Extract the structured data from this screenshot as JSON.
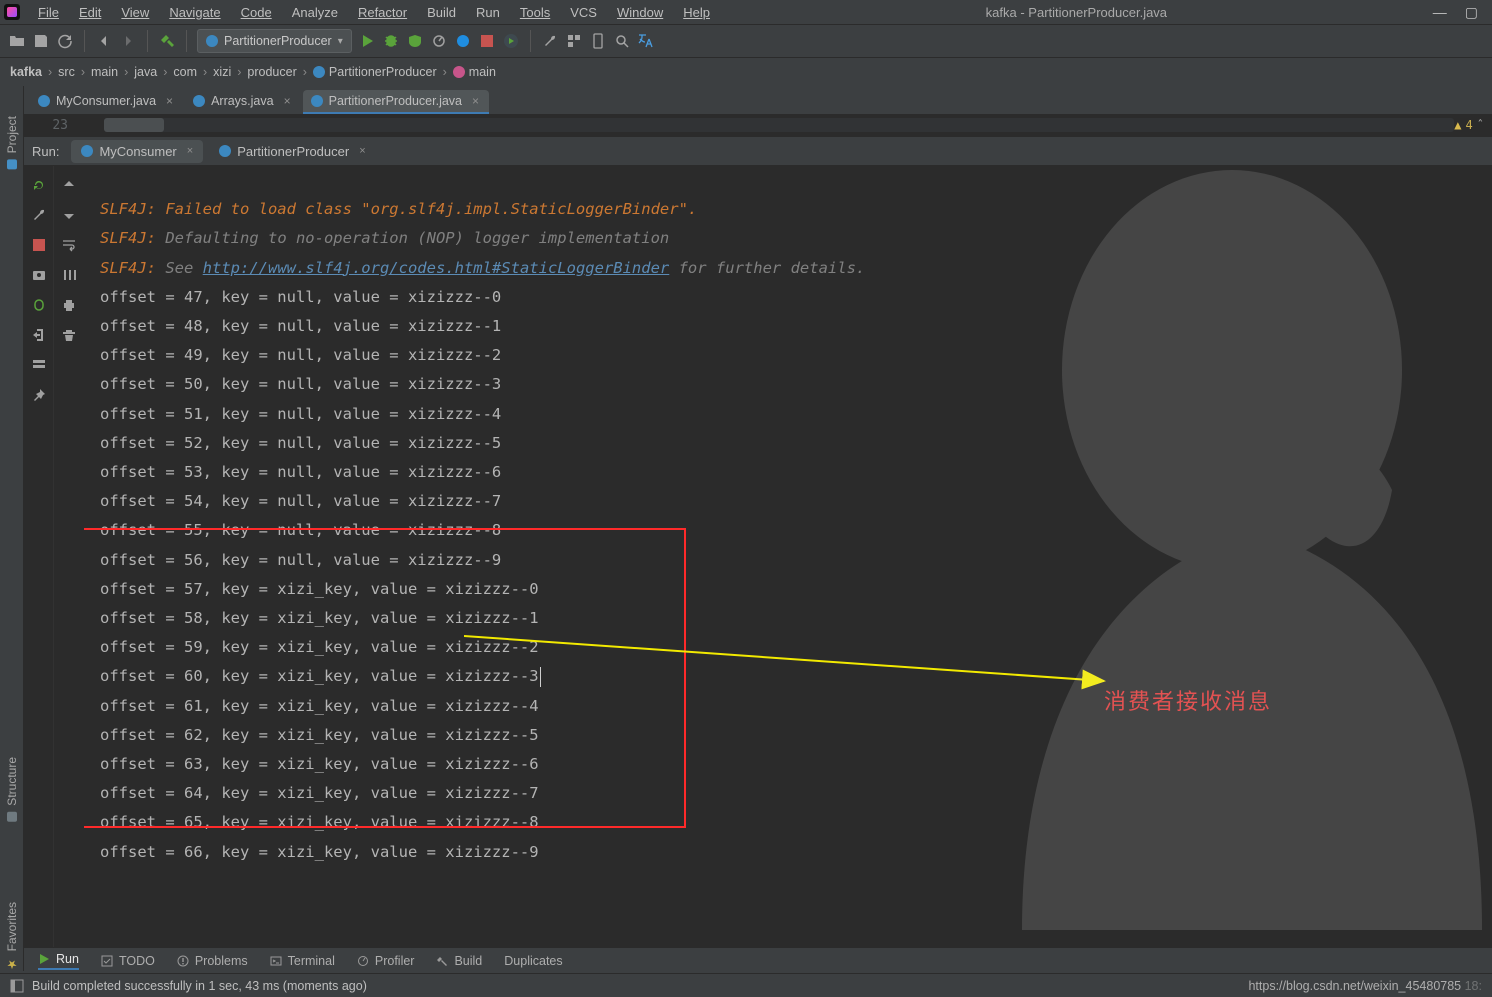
{
  "window": {
    "title": "kafka - PartitionerProducer.java"
  },
  "menu": {
    "file": "File",
    "edit": "Edit",
    "view": "View",
    "navigate": "Navigate",
    "code": "Code",
    "analyze": "Analyze",
    "refactor": "Refactor",
    "build": "Build",
    "run": "Run",
    "tools": "Tools",
    "vcs": "VCS",
    "window": "Window",
    "help": "Help"
  },
  "toolbar": {
    "run_config": "PartitionerProducer"
  },
  "breadcrumb": {
    "parts": [
      "kafka",
      "src",
      "main",
      "java",
      "com",
      "xizi",
      "producer"
    ],
    "class": "PartitionerProducer",
    "method": "main"
  },
  "editor_tabs": {
    "t1": "MyConsumer.java",
    "t2": "Arrays.java",
    "t3": "PartitionerProducer.java"
  },
  "editor": {
    "line_number": "23",
    "warning_count": "4"
  },
  "run_tool": {
    "label": "Run:",
    "tab1": "MyConsumer",
    "tab2": "PartitionerProducer"
  },
  "console": {
    "lead0": "SLF4J: Failed to load class \"org.slf4j.impl.StaticLoggerBinder\".",
    "l1_pref": "SLF4J:",
    "l1_rest": " Defaulting to no-operation (NOP) logger implementation",
    "l2_pref": "SLF4J:",
    "l2_see": " See ",
    "l2_url": "http://www.slf4j.org/codes.html#StaticLoggerBinder",
    "l2_rest": " for further details.",
    "rows": [
      "offset = 47, key = null, value = xizizzz--0",
      "offset = 48, key = null, value = xizizzz--1",
      "offset = 49, key = null, value = xizizzz--2",
      "offset = 50, key = null, value = xizizzz--3",
      "offset = 51, key = null, value = xizizzz--4",
      "offset = 52, key = null, value = xizizzz--5",
      "offset = 53, key = null, value = xizizzz--6",
      "offset = 54, key = null, value = xizizzz--7",
      "offset = 55, key = null, value = xizizzz--8",
      "offset = 56, key = null, value = xizizzz--9",
      "offset = 57, key = xizi_key, value = xizizzz--0",
      "offset = 58, key = xizi_key, value = xizizzz--1",
      "offset = 59, key = xizi_key, value = xizizzz--2",
      "offset = 60, key = xizi_key, value = xizizzz--3",
      "offset = 61, key = xizi_key, value = xizizzz--4",
      "offset = 62, key = xizi_key, value = xizizzz--5",
      "offset = 63, key = xizi_key, value = xizizzz--6",
      "offset = 64, key = xizi_key, value = xizizzz--7",
      "offset = 65, key = xizi_key, value = xizizzz--8",
      "offset = 66, key = xizi_key, value = xizizzz--9"
    ]
  },
  "annotation": {
    "label": "消费者接收消息"
  },
  "left_rail": {
    "project": "Project",
    "structure": "Structure",
    "favorites": "Favorites"
  },
  "bottom": {
    "run": "Run",
    "todo": "TODO",
    "problems": "Problems",
    "terminal": "Terminal",
    "profiler": "Profiler",
    "build": "Build",
    "duplicates": "Duplicates"
  },
  "status": {
    "msg": "Build completed successfully in 1 sec, 43 ms (moments ago)",
    "watermark": "https://blog.csdn.net/weixin_45480785",
    "right_small": "18:"
  }
}
